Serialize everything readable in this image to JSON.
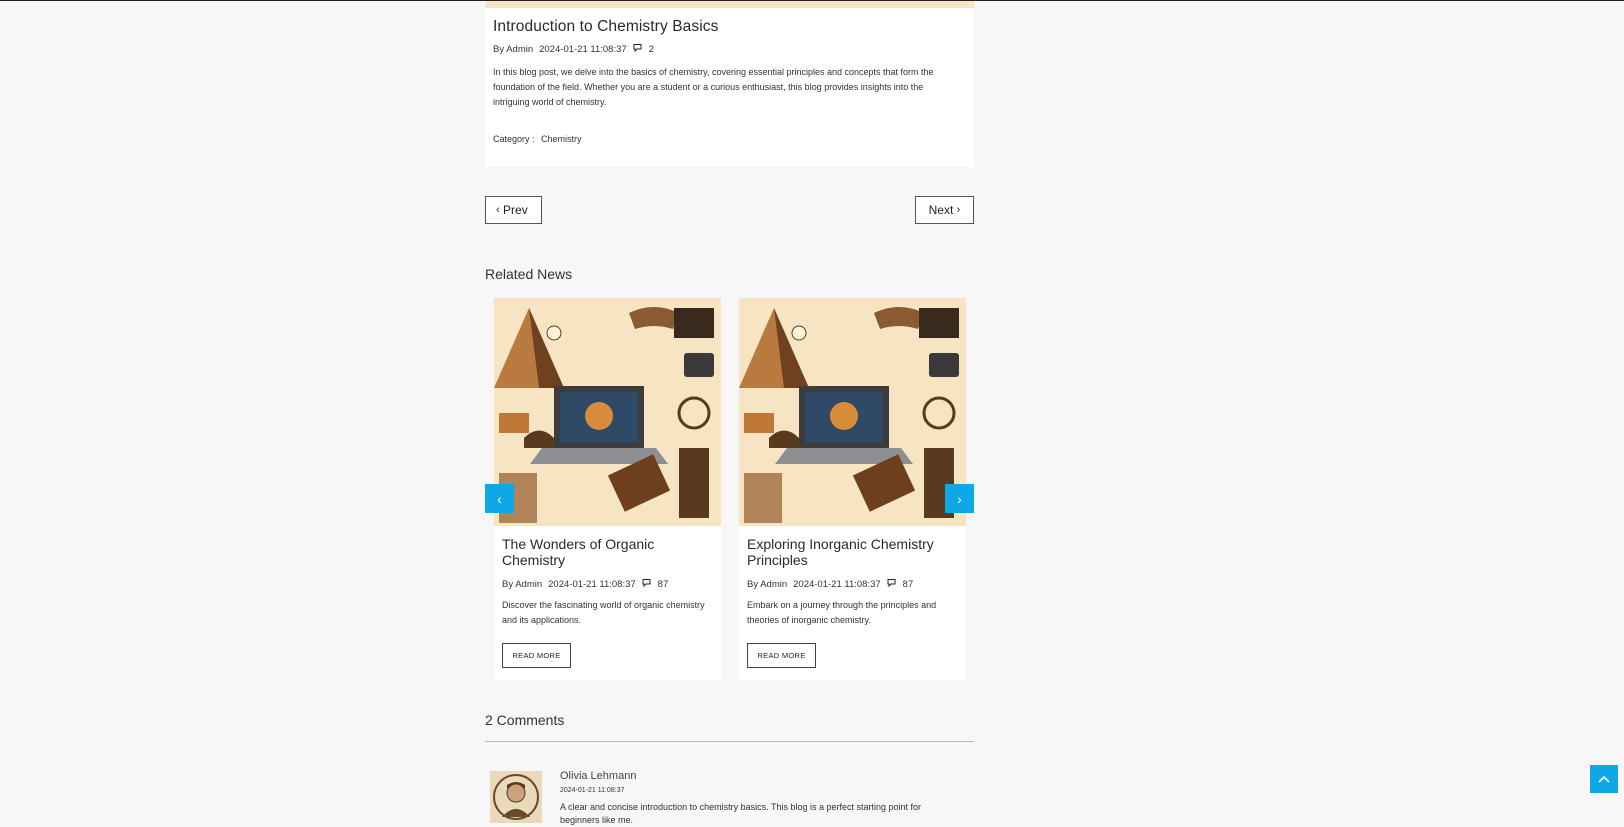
{
  "post": {
    "title": "Introduction to Chemistry Basics",
    "author": "By Admin",
    "date": "2024-01-21 11:08:37",
    "comment_count": "2",
    "excerpt": "In this blog post, we delve into the basics of chemistry, covering essential principles and concepts that form the foundation of the field. Whether you are a student or a curious enthusiast, this blog provides insights into the intriguing world of chemistry.",
    "category_label": "Category :",
    "category_value": "Chemistry"
  },
  "pager": {
    "prev_label": "Prev",
    "next_label": "Next"
  },
  "related": {
    "heading": "Related News",
    "cards": [
      {
        "title": "The Wonders of Organic Chemistry",
        "author": "By Admin",
        "date": "2024-01-21 11:08:37",
        "comments": "87",
        "excerpt": "Discover the fascinating world of organic chemistry and its applications.",
        "button": "READ MORE"
      },
      {
        "title": "Exploring Inorganic Chemistry Principles",
        "author": "By Admin",
        "date": "2024-01-21 11:08:37",
        "comments": "87",
        "excerpt": "Embark on a journey through the principles and theories of inorganic chemistry.",
        "button": "READ MORE"
      }
    ]
  },
  "comments": {
    "heading": "2 Comments",
    "items": [
      {
        "author": "Olivia Lehmann",
        "date": "2024-01-21 11:08:37",
        "text": "A clear and concise introduction to chemistry basics. This blog is a perfect starting point for beginners like me."
      }
    ]
  },
  "colors": {
    "accent": "#0fa8e6",
    "background": "#f7f7f7",
    "card": "#ffffff"
  }
}
